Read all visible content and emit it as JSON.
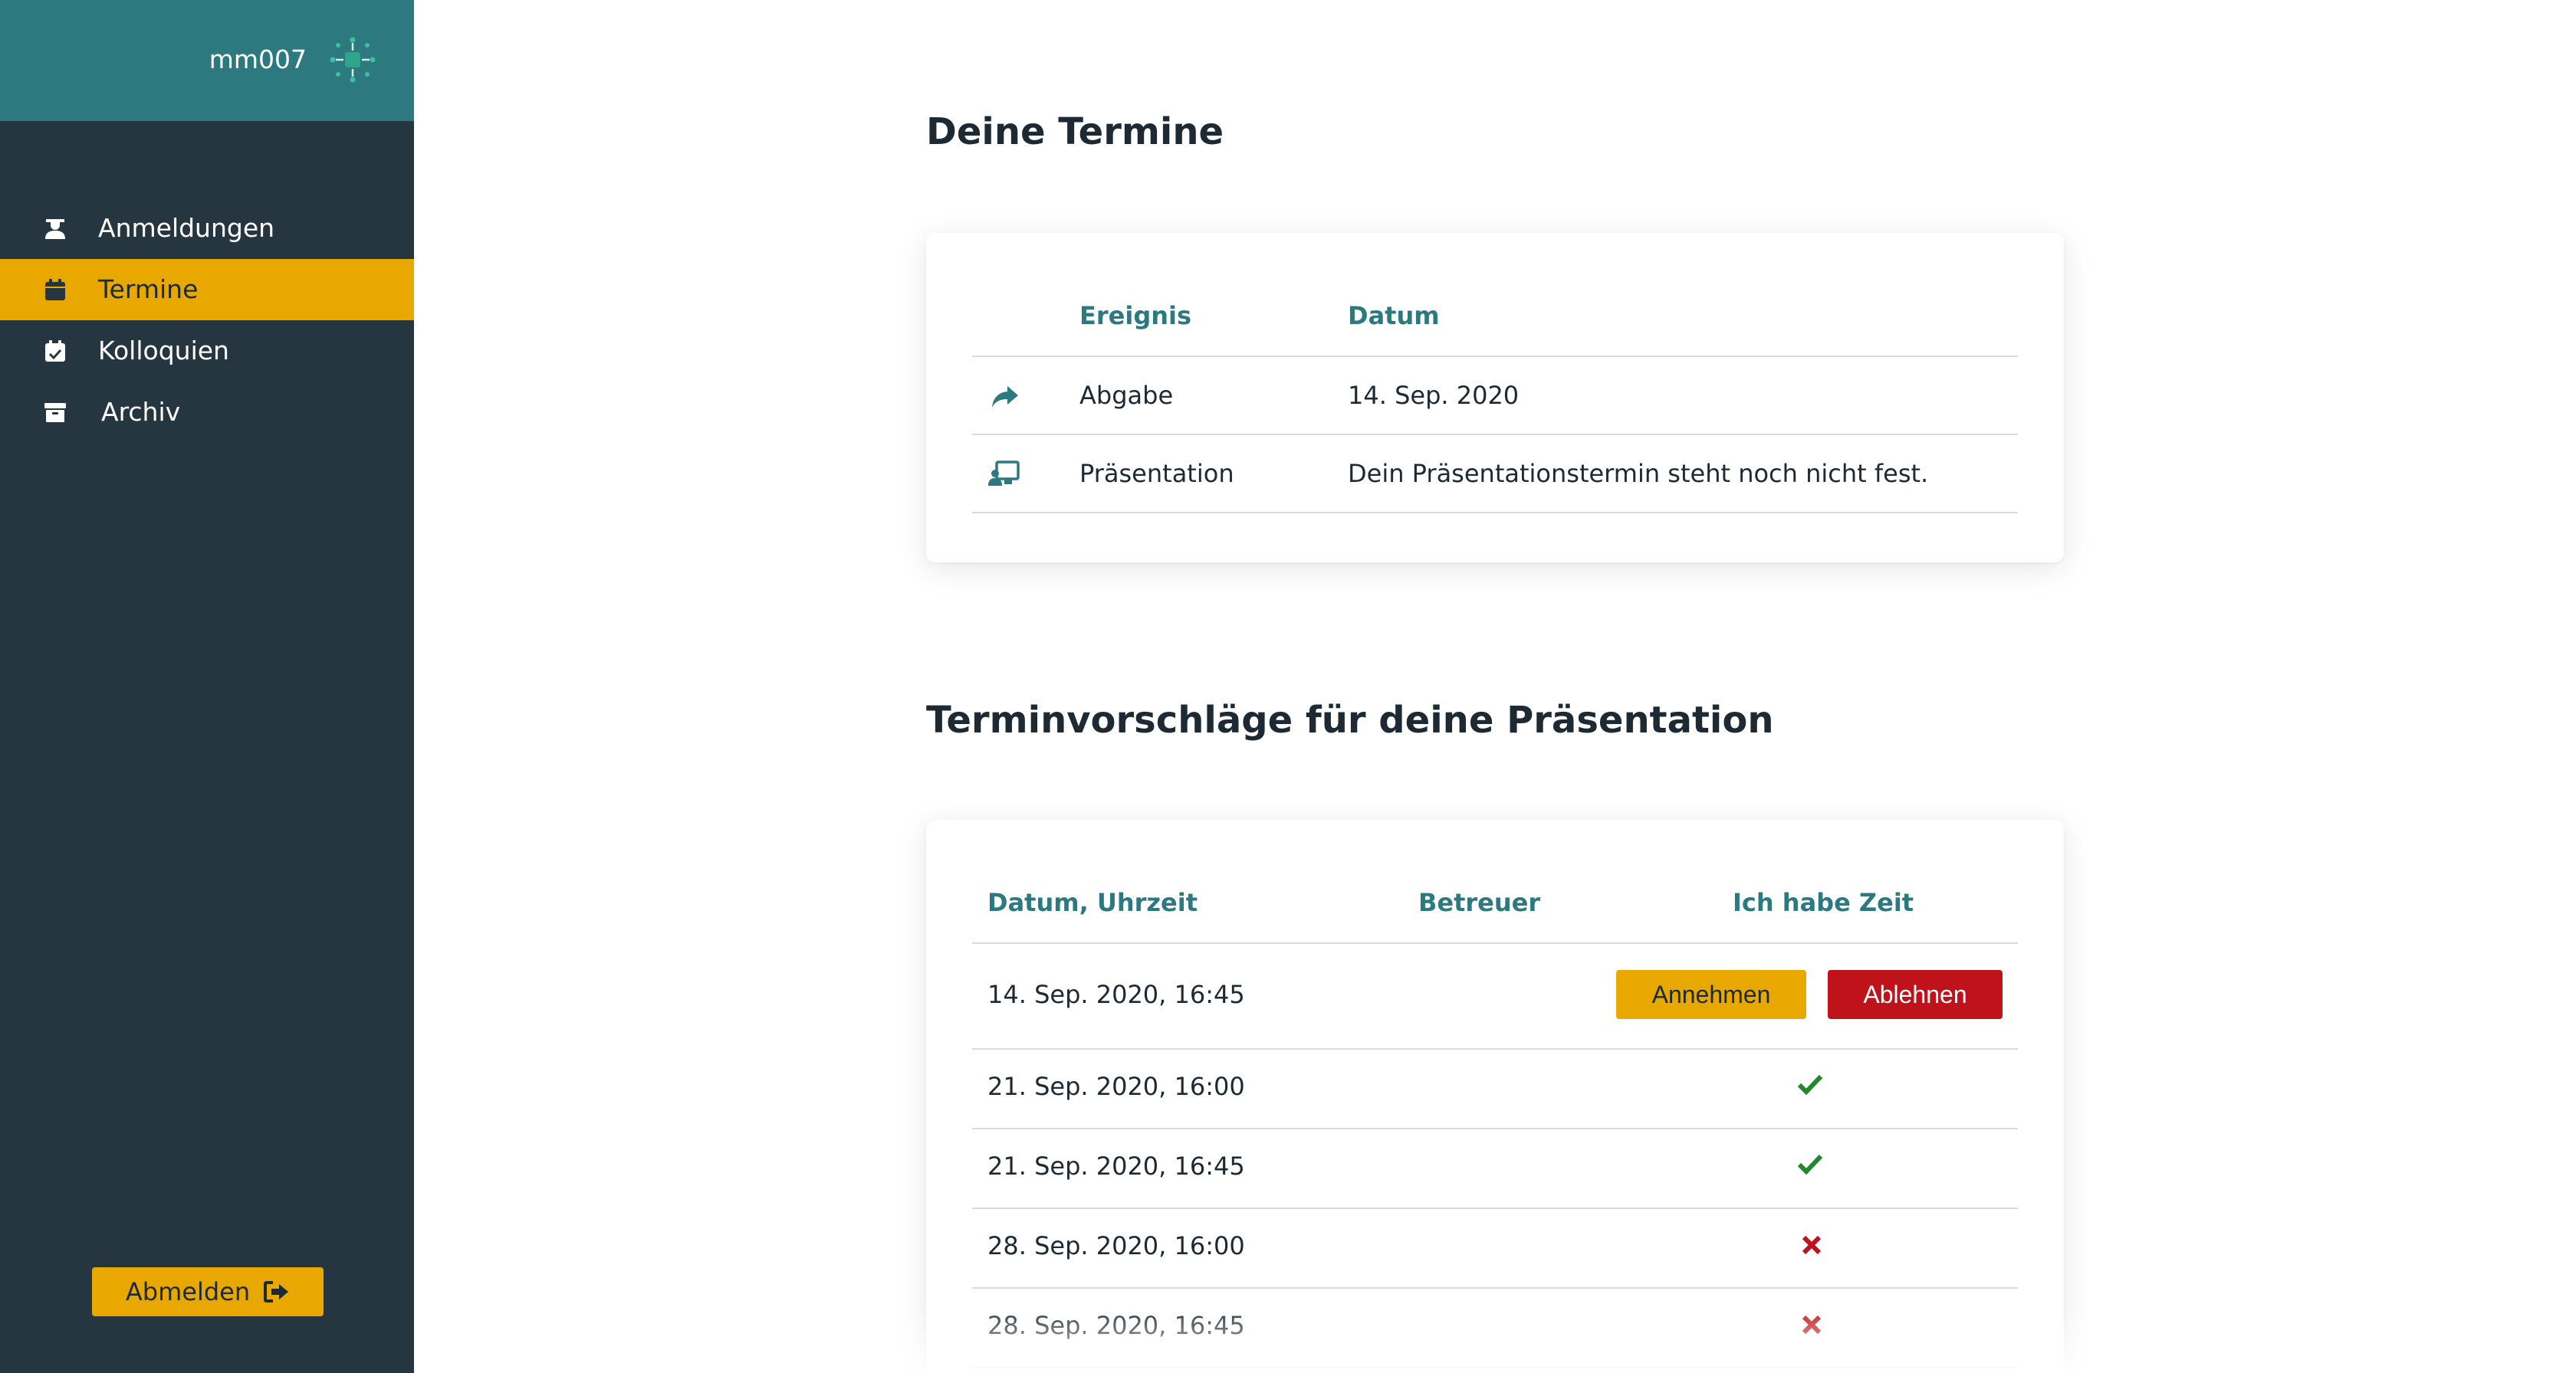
{
  "sidebar": {
    "username": "mm007",
    "logo_icon": "spinner-network-icon",
    "items": [
      {
        "label": "Anmeldungen",
        "icon": "user-graduate-icon",
        "active": false
      },
      {
        "label": "Termine",
        "icon": "calendar-icon",
        "active": true
      },
      {
        "label": "Kolloquien",
        "icon": "calendar-check-icon",
        "active": false
      },
      {
        "label": "Archiv",
        "icon": "archive-box-icon",
        "active": false
      }
    ],
    "logout_label": "Abmelden",
    "logout_icon": "sign-out-icon"
  },
  "appointments": {
    "title": "Deine Termine",
    "headers": {
      "event": "Ereignis",
      "date": "Datum"
    },
    "rows": [
      {
        "icon": "share-arrow-icon",
        "event": "Abgabe",
        "date": "14. Sep. 2020"
      },
      {
        "icon": "presentation-icon",
        "event": "Präsentation",
        "date": "Dein Präsentationstermin steht noch nicht fest."
      }
    ]
  },
  "proposals": {
    "title": "Terminvorschläge für deine Präsentation",
    "headers": {
      "datetime": "Datum, Uhrzeit",
      "supervisor": "Betreuer",
      "available": "Ich habe Zeit"
    },
    "rows": [
      {
        "datetime": "14. Sep. 2020, 16:45",
        "supervisor": "",
        "status": "pending",
        "accept_label": "Annehmen",
        "decline_label": "Ablehnen"
      },
      {
        "datetime": "21. Sep. 2020, 16:00",
        "supervisor": "",
        "status": "yes"
      },
      {
        "datetime": "21. Sep. 2020, 16:45",
        "supervisor": "",
        "status": "yes"
      },
      {
        "datetime": "28. Sep. 2020, 16:00",
        "supervisor": "",
        "status": "no"
      },
      {
        "datetime": "28. Sep. 2020, 16:45",
        "supervisor": "",
        "status": "no"
      }
    ]
  },
  "colors": {
    "sidebar": "#253641",
    "sidebar_header": "#2c7a80",
    "accent": "#e8a800",
    "heading_teal": "#2c7a80",
    "decline_red": "#c0121a",
    "check_green": "#1f8a2b",
    "cross_red": "#c0121a"
  }
}
